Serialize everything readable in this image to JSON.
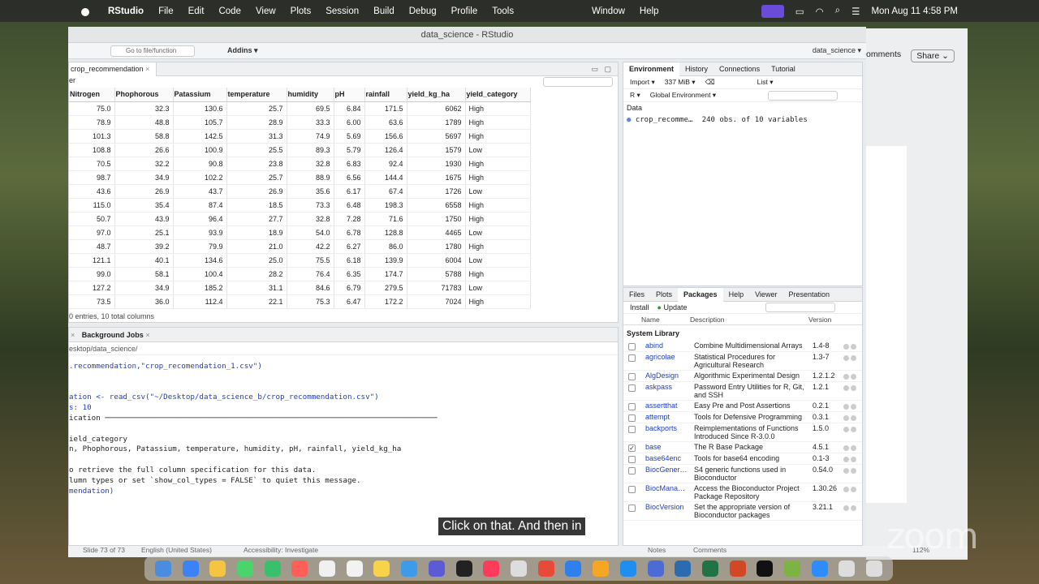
{
  "menubar": {
    "app": "RStudio",
    "items": [
      "File",
      "Edit",
      "Code",
      "View",
      "Plots",
      "Session",
      "Build",
      "Debug",
      "Profile",
      "Tools"
    ],
    "center_items": [
      "Window",
      "Help"
    ],
    "datetime": "Mon Aug 11  4:58 PM"
  },
  "window": {
    "title": "data_science - RStudio",
    "goto_placeholder": "Go to file/function",
    "addins": "Addins",
    "project": "data_science"
  },
  "source": {
    "tab": "crop_recommendation",
    "filter": "er",
    "columns": [
      "Nitrogen",
      "Phophorous",
      "Patassium",
      "temperature",
      "humidity",
      "pH",
      "rainfall",
      "yield_kg_ha",
      "yield_category"
    ],
    "rows": [
      [
        "75.0",
        "32.3",
        "130.6",
        "25.7",
        "69.5",
        "6.84",
        "171.5",
        "6062",
        "High"
      ],
      [
        "78.9",
        "48.8",
        "105.7",
        "28.9",
        "33.3",
        "6.00",
        "63.6",
        "1789",
        "High"
      ],
      [
        "101.3",
        "58.8",
        "142.5",
        "31.3",
        "74.9",
        "5.69",
        "156.6",
        "5697",
        "High"
      ],
      [
        "108.8",
        "26.6",
        "100.9",
        "25.5",
        "89.3",
        "5.79",
        "126.4",
        "1579",
        "Low"
      ],
      [
        "70.5",
        "32.2",
        "90.8",
        "23.8",
        "32.8",
        "6.83",
        "92.4",
        "1930",
        "High"
      ],
      [
        "98.7",
        "34.9",
        "102.2",
        "25.7",
        "88.9",
        "6.56",
        "144.4",
        "1675",
        "High"
      ],
      [
        "43.6",
        "26.9",
        "43.7",
        "26.9",
        "35.6",
        "6.17",
        "67.4",
        "1726",
        "Low"
      ],
      [
        "115.0",
        "35.4",
        "87.4",
        "18.5",
        "73.3",
        "6.48",
        "198.3",
        "6558",
        "High"
      ],
      [
        "50.7",
        "43.9",
        "96.4",
        "27.7",
        "32.8",
        "7.28",
        "71.6",
        "1750",
        "High"
      ],
      [
        "97.0",
        "25.1",
        "93.9",
        "18.9",
        "54.0",
        "6.78",
        "128.8",
        "4465",
        "Low"
      ],
      [
        "48.7",
        "39.2",
        "79.9",
        "21.0",
        "42.2",
        "6.27",
        "86.0",
        "1780",
        "High"
      ],
      [
        "121.1",
        "40.1",
        "134.6",
        "25.0",
        "75.5",
        "6.18",
        "139.9",
        "6004",
        "Low"
      ],
      [
        "99.0",
        "58.1",
        "100.4",
        "28.2",
        "76.4",
        "6.35",
        "174.7",
        "5788",
        "High"
      ],
      [
        "127.2",
        "34.9",
        "185.2",
        "31.1",
        "84.6",
        "6.79",
        "279.5",
        "71783",
        "Low"
      ],
      [
        "73.5",
        "36.0",
        "112.4",
        "22.1",
        "75.3",
        "6.47",
        "172.2",
        "7024",
        "High"
      ]
    ],
    "status": "0 entries, 10 total columns"
  },
  "console": {
    "tab": "Background Jobs",
    "path": "esktop/data_science/",
    "lines": [
      {
        "text": ".recommendation,\"crop_recomendation_1.csv\")",
        "color": "blue"
      },
      {
        "text": "",
        "color": ""
      },
      {
        "text": "",
        "color": ""
      },
      {
        "text": "ation <- read_csv(\"~/Desktop/data_science_b/crop_recommendation.csv\")",
        "color": "blue"
      },
      {
        "text": "s: 10",
        "color": "blue"
      },
      {
        "text": "ication ──────────────────────────────────────────────────────────────────────────",
        "color": ""
      },
      {
        "text": "",
        "color": ""
      },
      {
        "text": "ield_category",
        "color": ""
      },
      {
        "text": "n, Phophorous, Patassium, temperature, humidity, pH, rainfall, yield_kg_ha",
        "color": ""
      },
      {
        "text": "",
        "color": ""
      },
      {
        "text": "o retrieve the full column specification for this data.",
        "color": ""
      },
      {
        "text": "lumn types or set `show_col_types = FALSE` to quiet this message.",
        "color": ""
      },
      {
        "text": "mendation)",
        "color": "blue"
      }
    ]
  },
  "environment": {
    "tabs": [
      "Environment",
      "History",
      "Connections",
      "Tutorial"
    ],
    "import": "Import",
    "memory": "337 MiB",
    "view": "List",
    "lang": "R",
    "scope": "Global Environment",
    "section": "Data",
    "items": [
      {
        "name": "crop_recomme…",
        "value": "240 obs. of 10 variables"
      }
    ]
  },
  "packages": {
    "tabs": [
      "Files",
      "Plots",
      "Packages",
      "Help",
      "Viewer",
      "Presentation"
    ],
    "install": "Install",
    "update": "Update",
    "headers": [
      "Name",
      "Description",
      "Version"
    ],
    "section": "System Library",
    "list": [
      {
        "name": "abind",
        "desc": "Combine Multidimensional Arrays",
        "ver": "1.4-8",
        "checked": false
      },
      {
        "name": "agricolae",
        "desc": "Statistical Procedures for Agricultural Research",
        "ver": "1.3-7",
        "checked": false
      },
      {
        "name": "AlgDesign",
        "desc": "Algorithmic Experimental Design",
        "ver": "1.2.1.2",
        "checked": false
      },
      {
        "name": "askpass",
        "desc": "Password Entry Utilities for R, Git, and SSH",
        "ver": "1.2.1",
        "checked": false
      },
      {
        "name": "assertthat",
        "desc": "Easy Pre and Post Assertions",
        "ver": "0.2.1",
        "checked": false
      },
      {
        "name": "attempt",
        "desc": "Tools for Defensive Programming",
        "ver": "0.3.1",
        "checked": false
      },
      {
        "name": "backports",
        "desc": "Reimplementations of Functions Introduced Since R-3.0.0",
        "ver": "1.5.0",
        "checked": false
      },
      {
        "name": "base",
        "desc": "The R Base Package",
        "ver": "4.5.1",
        "checked": true
      },
      {
        "name": "base64enc",
        "desc": "Tools for base64 encoding",
        "ver": "0.1-3",
        "checked": false
      },
      {
        "name": "BiocGener…",
        "desc": "S4 generic functions used in Bioconductor",
        "ver": "0.54.0",
        "checked": false
      },
      {
        "name": "BiocMana…",
        "desc": "Access the Bioconductor Project Package Repository",
        "ver": "1.30.26",
        "checked": false
      },
      {
        "name": "BiocVersion",
        "desc": "Set the appropriate version of Bioconductor packages",
        "ver": "3.21.1",
        "checked": false
      }
    ]
  },
  "powerpoint": {
    "comments": "omments",
    "share": "Share",
    "zoom_pct": "112%"
  },
  "statusbar": {
    "slide": "Slide 73 of 73",
    "lang": "English (United States)",
    "access": "Accessibility: Investigate",
    "notes": "Notes",
    "comments": "Comments"
  },
  "caption": "Click on that. And then in",
  "zoom_watermark": "zoom",
  "colors": {
    "accent": "#1f3fbf",
    "zoom": "#6a4cd9"
  }
}
